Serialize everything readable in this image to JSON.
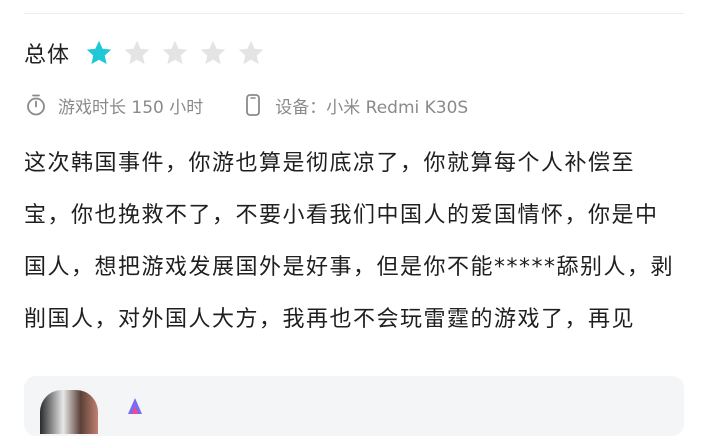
{
  "rating": {
    "label": "总体",
    "value": 1,
    "max": 5,
    "active_color": "#1ec8d6",
    "inactive_color": "#e4e4e4",
    "star_icon": "star-icon"
  },
  "meta": {
    "playtime": {
      "icon": "stopwatch-icon",
      "text": "游戏时长 150 小时"
    },
    "device": {
      "icon": "phone-icon",
      "text": "设备：小米 Redmi K30S"
    }
  },
  "review": {
    "lines": [
      "这次韩国事件，你游也算是彻底凉了，你就算每个人补偿至",
      "宝，你也挽救不了，不要小看我们中国人的爱国情怀，你是中",
      "国人，想把游戏发展国外是好事，但是你不能*****舔别人，剥",
      "削国人，对外国人大方，我再也不会玩雷霆的游戏了，再见"
    ]
  },
  "reply_card": {
    "avatar_icon": "avatar",
    "badge_icon": "badge-icon"
  }
}
